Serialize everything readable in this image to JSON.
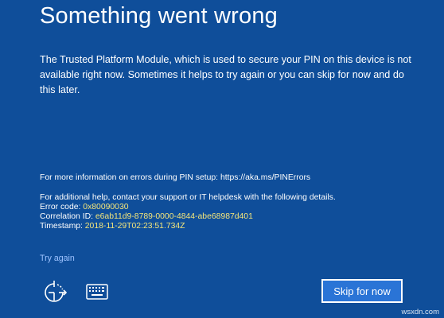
{
  "error_screen": {
    "title": "Something went wrong",
    "message": "The Trusted Platform Module, which is used to secure your PIN on this device is not available right now. Sometimes it helps to try again or you can skip for now and do this later.",
    "info_link_text": "For more information on errors during PIN setup: https://aka.ms/PINErrors",
    "help_text": "For additional help, contact your support or IT helpdesk with the following details.",
    "error_code_label": "Error code: ",
    "error_code_value": "0x80090030",
    "correlation_label": "Correlation ID: ",
    "correlation_value": "e6ab11d9-8789-0000-4844-abe68987d401",
    "timestamp_label": "Timestamp: ",
    "timestamp_value": "2018-11-29T02:23:51.734Z",
    "try_again_label": "Try again",
    "skip_button_label": "Skip for now"
  },
  "icons": {
    "ease_of_access": "ease-of-access-icon",
    "keyboard": "keyboard-icon"
  },
  "colors": {
    "background": "#0f4e9a",
    "highlight_value": "#f5e67a",
    "link": "#9ec3ff",
    "button": "#2a74d6"
  },
  "watermark": "wsxdn.com"
}
